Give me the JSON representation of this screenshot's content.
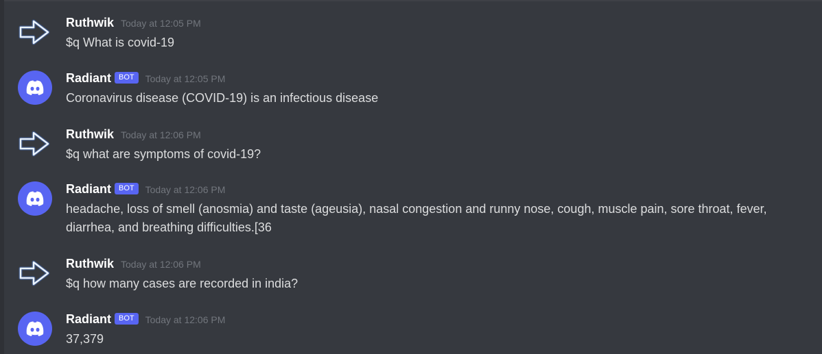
{
  "channel": {
    "messages": [
      {
        "author": "Ruthwik",
        "avatar": "arrow-right-icon",
        "timestamp": "Today at 12:05 PM",
        "text": "$q What is covid-19"
      },
      {
        "author": "Radiant",
        "bot_tag": "BOT",
        "avatar": "discord-logo-icon",
        "timestamp": "Today at 12:05 PM",
        "text": "Coronavirus disease (COVID-19) is an infectious disease"
      },
      {
        "author": "Ruthwik",
        "avatar": "arrow-right-icon",
        "timestamp": "Today at 12:06 PM",
        "text": "$q what are symptoms of covid-19?"
      },
      {
        "author": "Radiant",
        "bot_tag": "BOT",
        "avatar": "discord-logo-icon",
        "timestamp": "Today at 12:06 PM",
        "text": "headache, loss of smell (anosmia) and taste (ageusia), nasal congestion and runny nose, cough, muscle pain, sore throat, fever, diarrhea, and breathing difficulties.[36"
      },
      {
        "author": "Ruthwik",
        "avatar": "arrow-right-icon",
        "timestamp": "Today at 12:06 PM",
        "text": "$q how many cases are recorded in india?"
      },
      {
        "author": "Radiant",
        "bot_tag": "BOT",
        "avatar": "discord-logo-icon",
        "timestamp": "Today at 12:06 PM",
        "text": "37,379"
      }
    ]
  },
  "colors": {
    "background": "#36393f",
    "username": "#ffffff",
    "text": "#dcddde",
    "timestamp": "#72767d",
    "bot_tag": "#5865f2",
    "arrow_glow": "#4f8dff"
  }
}
